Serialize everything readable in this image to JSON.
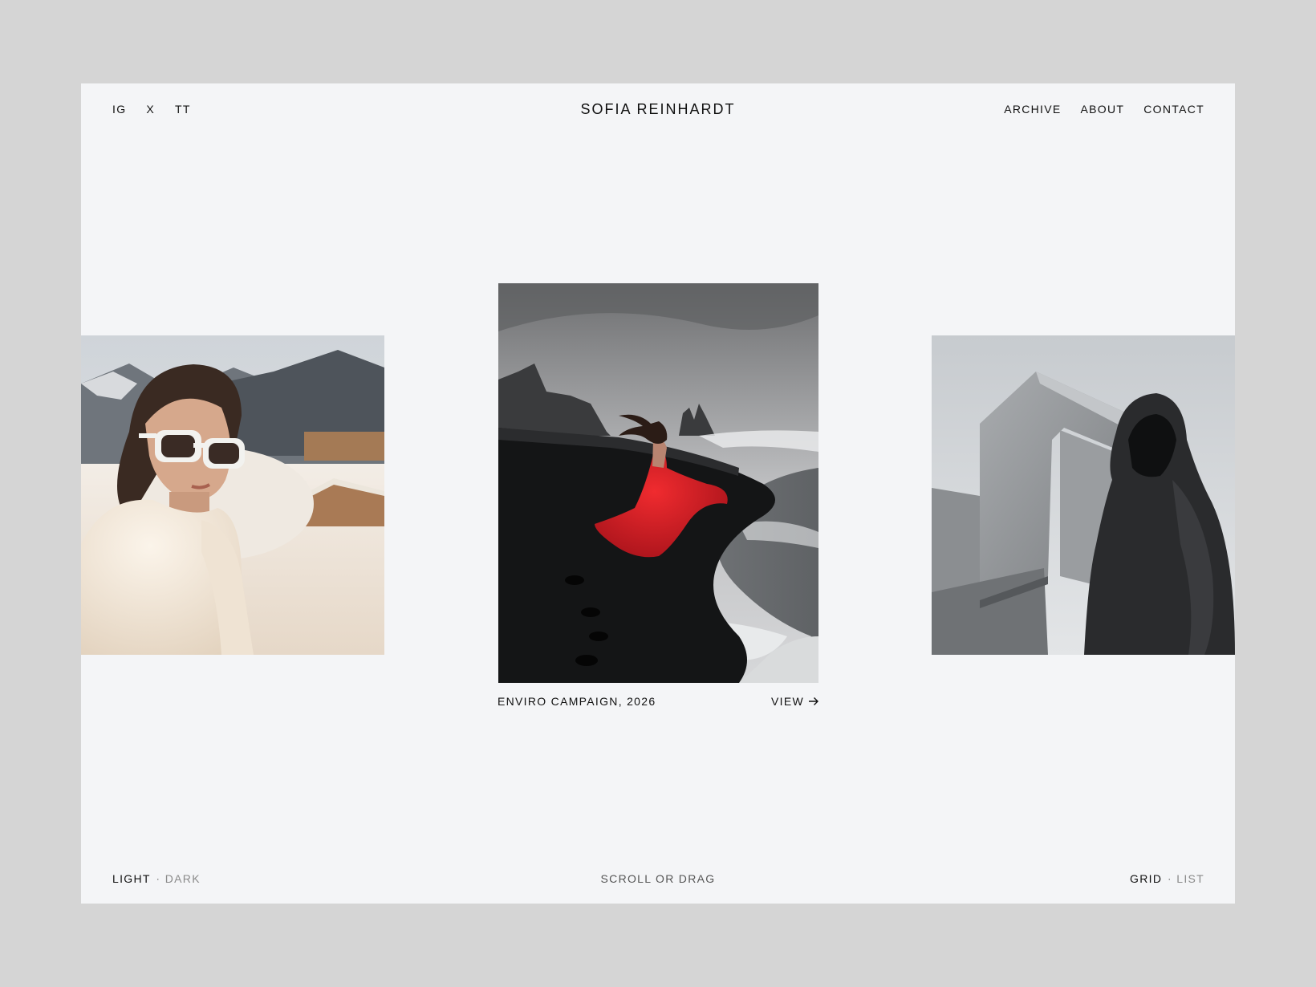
{
  "header": {
    "social": [
      "IG",
      "X",
      "TT"
    ],
    "brand": "SOFIA REINHARDT",
    "nav": [
      "ARCHIVE",
      "ABOUT",
      "CONTACT"
    ]
  },
  "gallery": {
    "featured": {
      "caption": "ENVIRO CAMPAIGN, 2026",
      "view_label": "VIEW"
    }
  },
  "footer": {
    "theme": {
      "active": "LIGHT",
      "inactive": "DARK",
      "separator": "·"
    },
    "hint": "SCROLL OR DRAG",
    "view_mode": {
      "active": "GRID",
      "inactive": "LIST",
      "separator": "·"
    }
  },
  "colors": {
    "page_bg": "#d5d5d5",
    "frame_bg": "#f4f5f7",
    "text": "#111111",
    "muted": "#8a8a8a",
    "accent_dress": "#d11a22"
  }
}
